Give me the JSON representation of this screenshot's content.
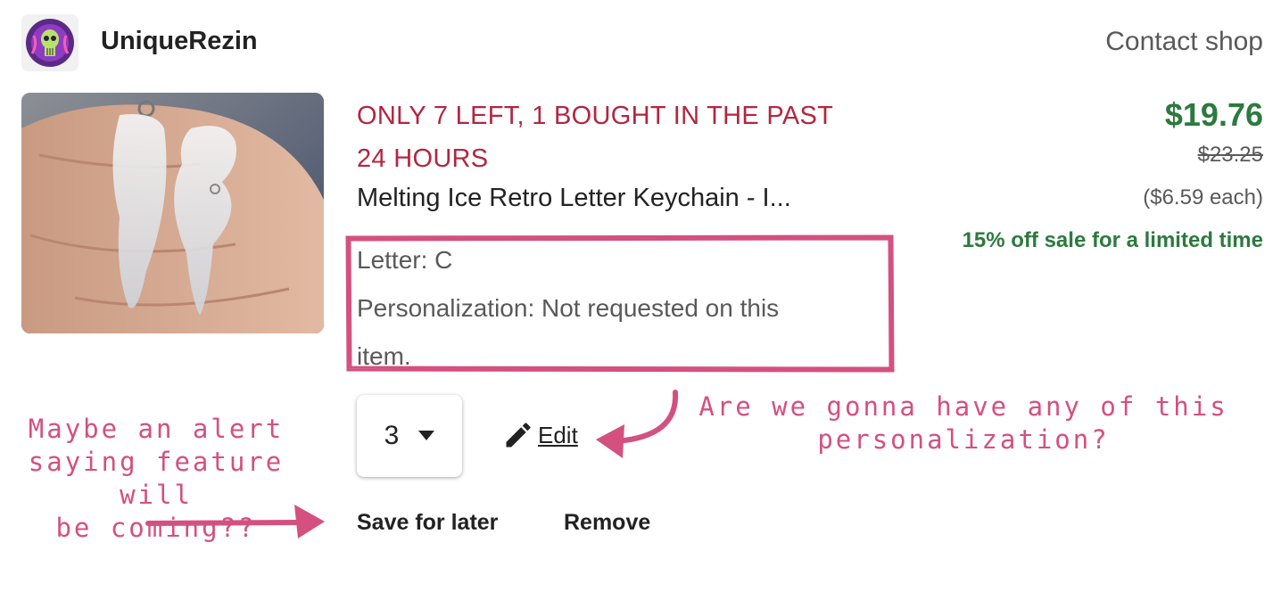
{
  "shop": {
    "name": "UniqueRezin",
    "contact_label": "Contact shop",
    "avatar_icon": "skull-avatar-icon"
  },
  "product": {
    "stock_alert_line1": "ONLY 7 LEFT, 1 BOUGHT IN THE PAST",
    "stock_alert_line2": "24 HOURS",
    "title": "Melting Ice Retro Letter Keychain - I...",
    "variation_letter": "Letter: C",
    "personalization_line1": "Personalization: Not requested on this",
    "personalization_line2": "item."
  },
  "pricing": {
    "price": "$19.76",
    "original_price": "$23.25",
    "each": "($6.59 each)",
    "sale_note": "15% off sale for a limited time"
  },
  "controls": {
    "quantity": "3",
    "edit_label": "Edit",
    "save_for_later": "Save for later",
    "remove": "Remove"
  },
  "annotations": {
    "left_line1": "Maybe an alert",
    "left_line2": "saying feature will",
    "left_line3": "be coming??",
    "right_line1": "Are we gonna have any of this",
    "right_line2": "personalization?"
  },
  "colors": {
    "alert": "#b2263f",
    "price_green": "#2c7a3e",
    "annotation_pink": "#d4507f"
  }
}
